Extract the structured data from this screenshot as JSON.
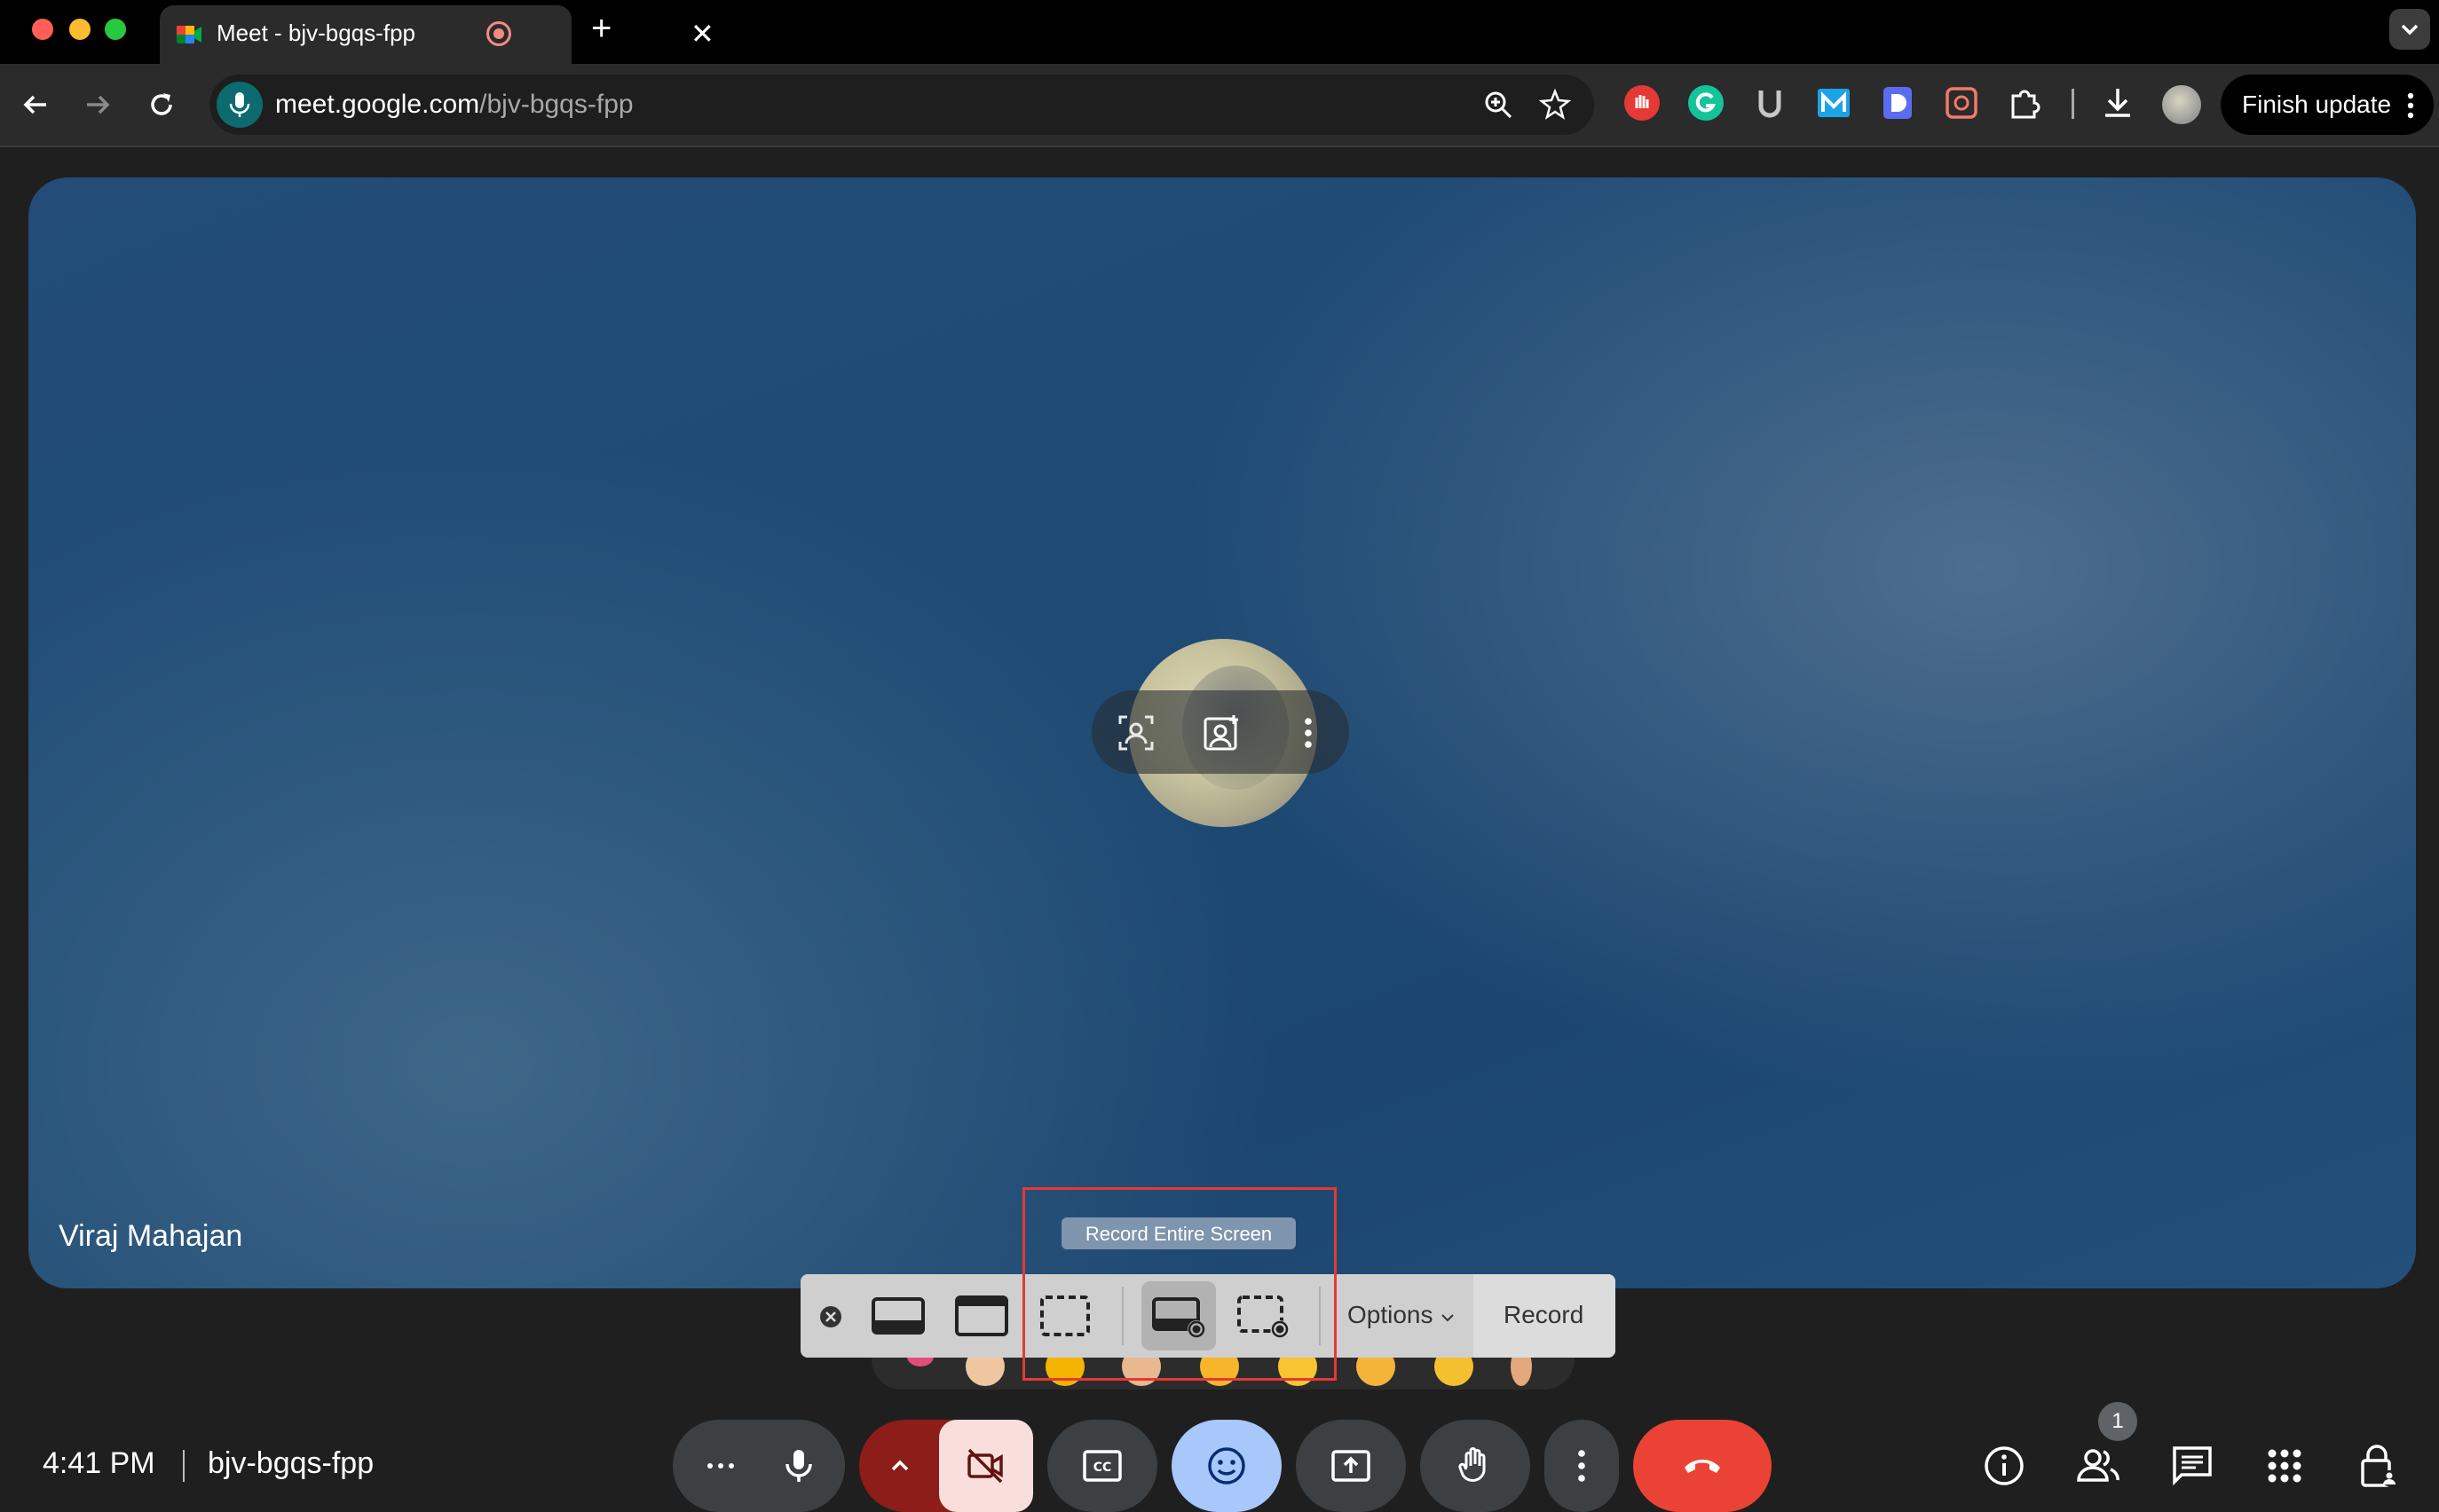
{
  "browser": {
    "tab_title": "Meet - bjv-bgqs-fpp",
    "url_host": "meet.google.com",
    "url_path": "/bjv-bgqs-fpp",
    "finish_update_label": "Finish update"
  },
  "meeting": {
    "participant_name": "Viraj Mahajan",
    "time": "4:41 PM",
    "code": "bjv-bgqs-fpp",
    "participants_count": "1"
  },
  "screenshot_toolbar": {
    "tooltip": "Record Entire Screen",
    "options_label": "Options",
    "record_label": "Record"
  },
  "colors": {
    "end_call": "#ea4335",
    "camera_off_bg": "#f9dedc",
    "reactions_bg": "#a8c7fa",
    "highlight": "#e53935"
  }
}
